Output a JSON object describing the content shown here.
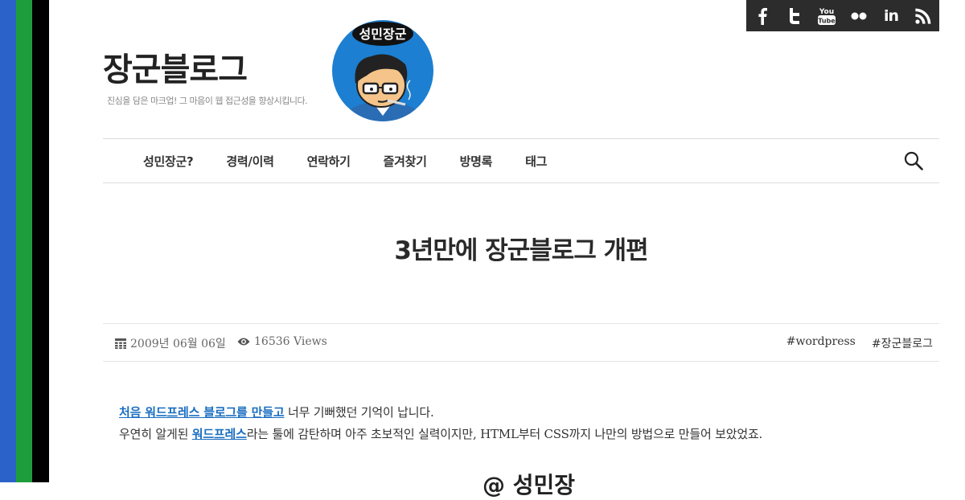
{
  "site": {
    "title": "장군블로그",
    "tagline": "진심을 담은 마크업! 그 마음이 웹 접근성을 향상시킵니다."
  },
  "avatar": {
    "label": "성민장군"
  },
  "social": {
    "items": [
      {
        "name": "facebook-icon"
      },
      {
        "name": "twitter-icon"
      },
      {
        "name": "youtube-icon",
        "text_top": "You",
        "text_bottom": "Tube"
      },
      {
        "name": "flickr-icon"
      },
      {
        "name": "linkedin-icon",
        "text": "in"
      },
      {
        "name": "rss-icon"
      }
    ],
    "bg_color": "#2c2c2c"
  },
  "nav": {
    "items": [
      {
        "label": "성민장군?"
      },
      {
        "label": "경력/이력"
      },
      {
        "label": "연락하기"
      },
      {
        "label": "즐겨찾기"
      },
      {
        "label": "방명록"
      },
      {
        "label": "태그"
      }
    ]
  },
  "post": {
    "title": "3년만에 장군블로그 개편",
    "date": "2009년 06월 06일",
    "views": "16536 Views",
    "tags": [
      "#wordpress",
      "#장군블로그"
    ],
    "paragraph1": {
      "link": "처음 워드프레스 블로그를 만들고",
      "rest": " 너무 기뻐했던 기억이 납니다."
    },
    "paragraph2": {
      "pre": "우연히 알게된 ",
      "link": "워드프레스",
      "rest": "라는 툴에 감탄하며 아주 초보적인 실력이지만, HTML부터 CSS까지 나만의 방법으로 만들어 보았었죠."
    },
    "cut_text": "@ 성민장"
  },
  "colors": {
    "stripe_blue": "#2a62c9",
    "stripe_green": "#1e9e3a",
    "stripe_black": "#000000",
    "link": "#1a6ec0",
    "avatar_bg": "#1c7fd1"
  }
}
